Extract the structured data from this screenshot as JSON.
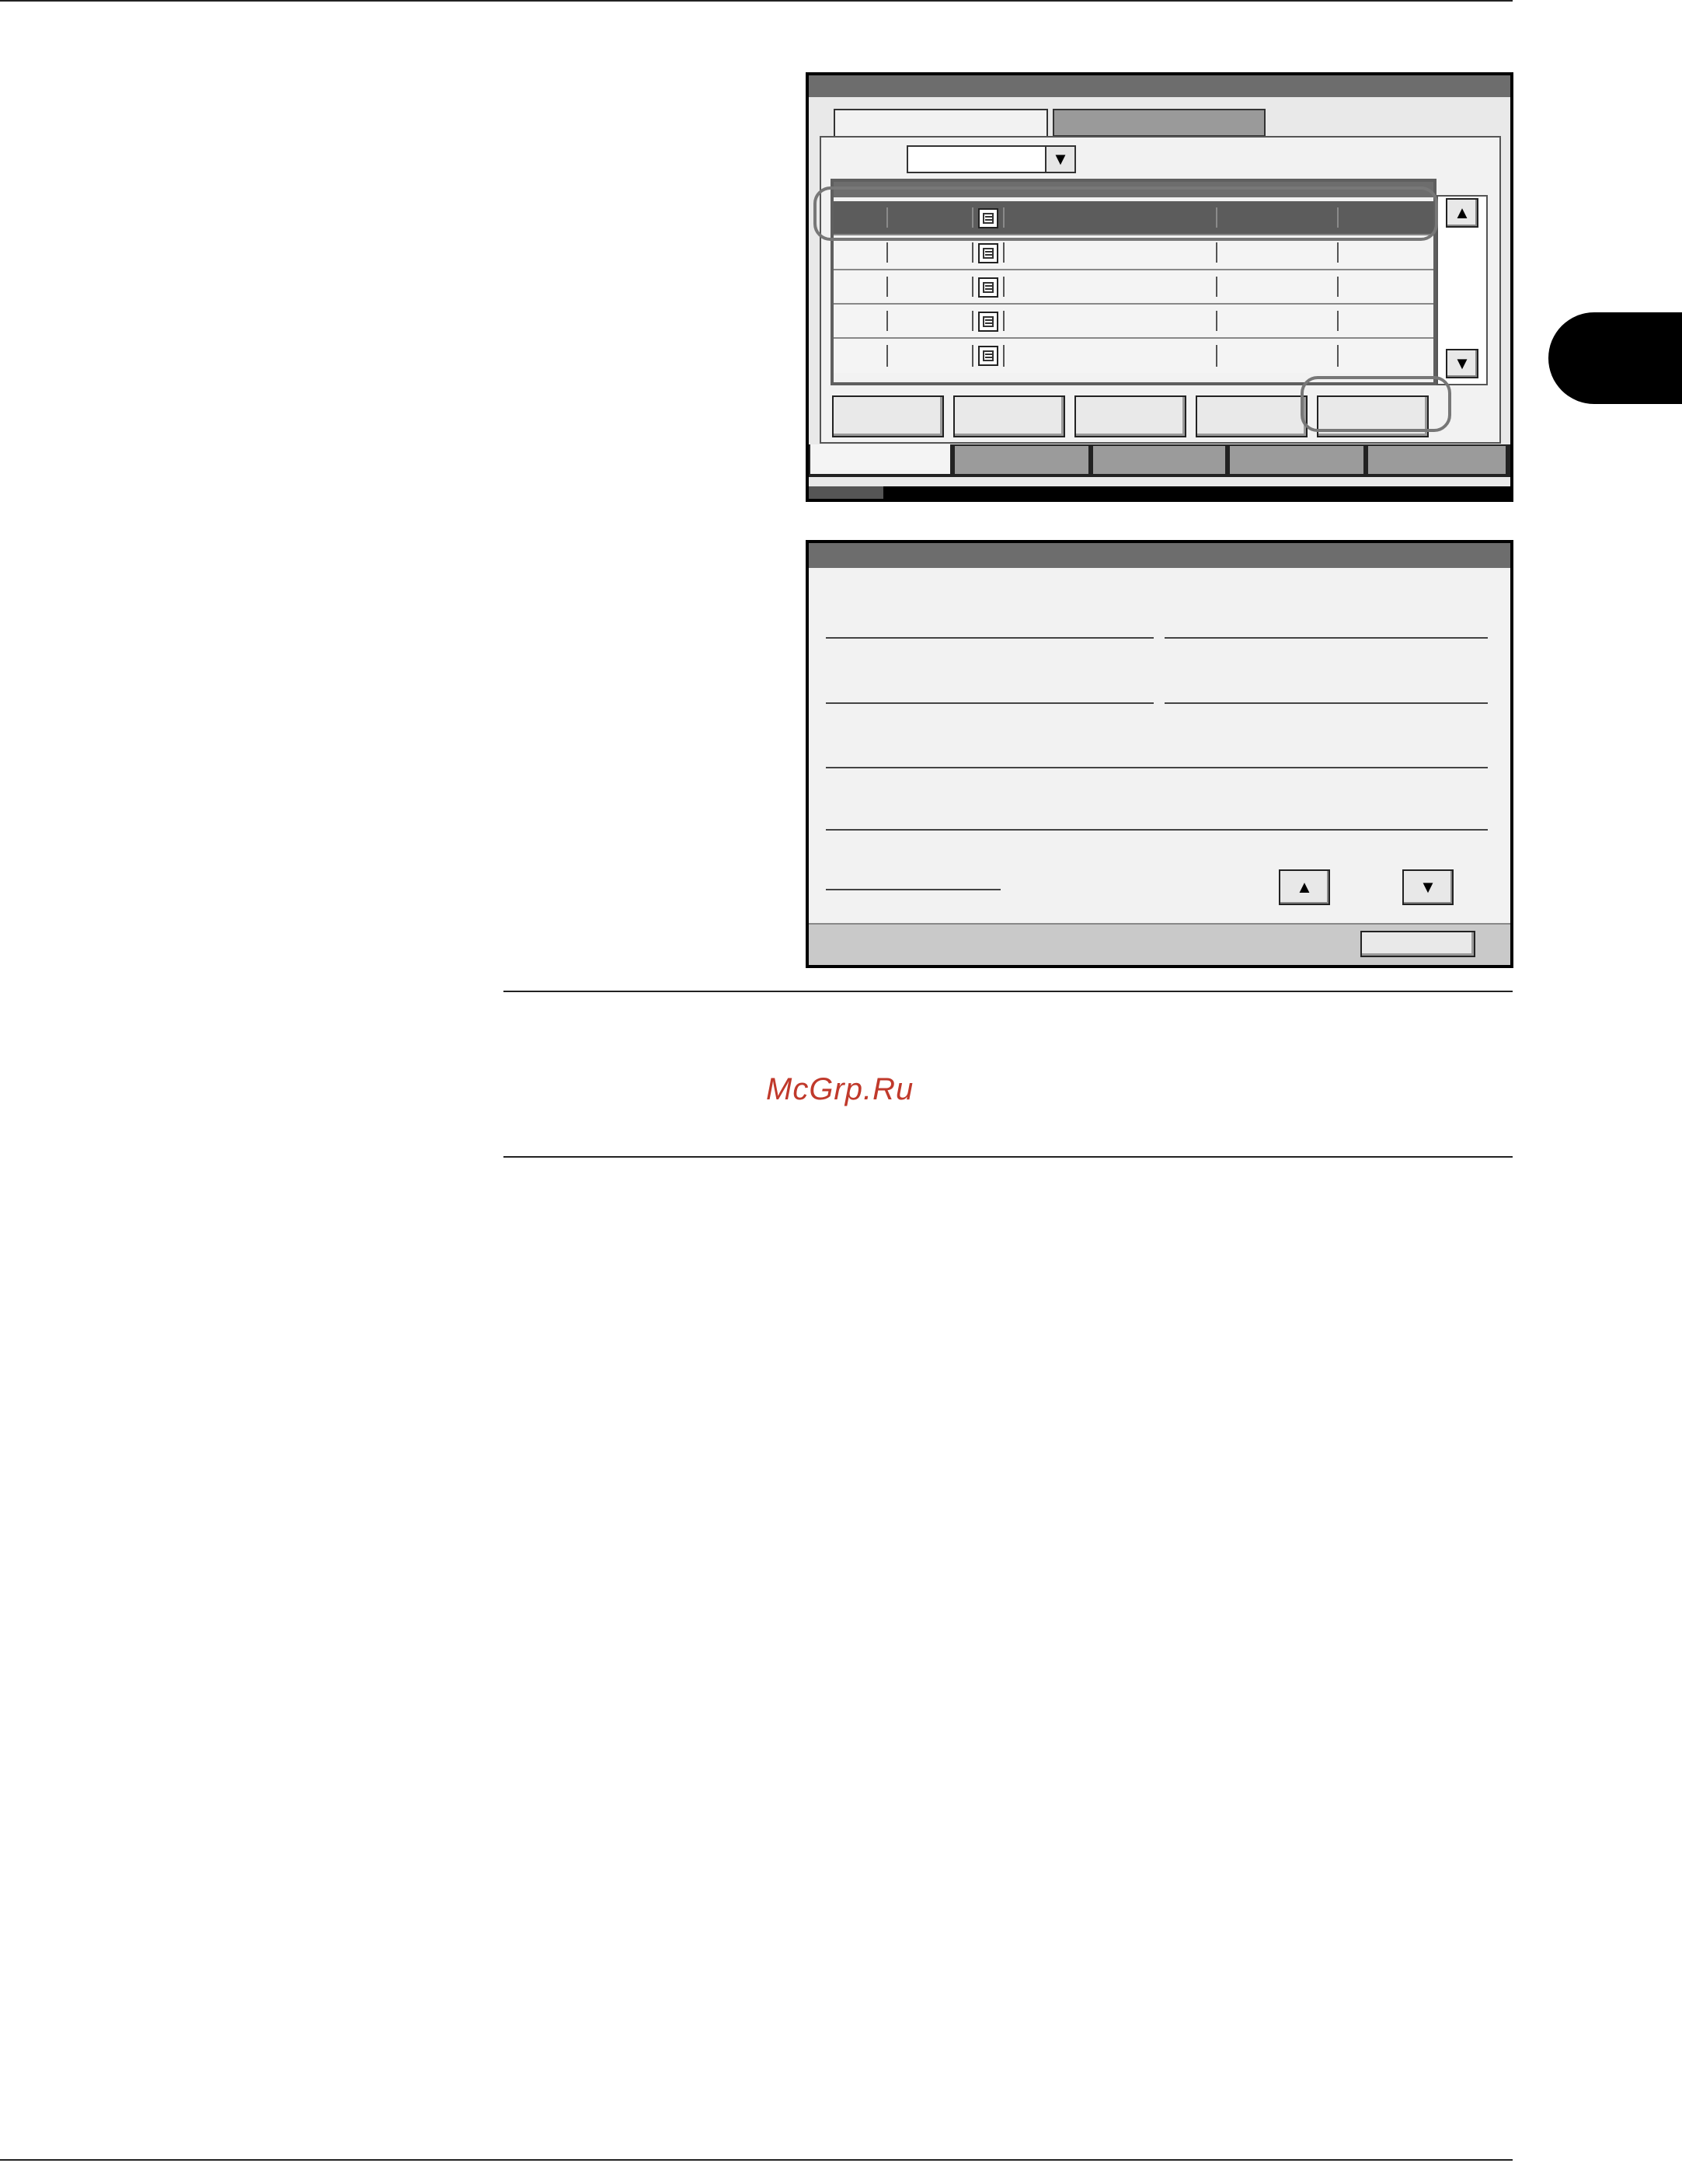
{
  "watermark": {
    "text": "McGrp.Ru"
  },
  "screen1": {
    "tabs": [
      "",
      ""
    ],
    "dropdown": {
      "value": "",
      "arrow_icon": "down-triangle-icon"
    },
    "list": {
      "rows": [
        {
          "selected": true,
          "icon": "document-icon"
        },
        {
          "selected": false,
          "icon": "document-icon"
        },
        {
          "selected": false,
          "icon": "document-icon"
        },
        {
          "selected": false,
          "icon": "document-icon"
        },
        {
          "selected": false,
          "icon": "document-icon"
        }
      ]
    },
    "action_buttons": [
      "",
      "",
      "",
      "",
      ""
    ],
    "bottom_tabs": [
      "",
      "",
      "",
      "",
      ""
    ]
  },
  "screen2": {
    "close_button": "",
    "scroll_up_icon": "up-triangle-icon",
    "scroll_down_icon": "down-triangle-icon"
  },
  "colors": {
    "title_bar": "#6d6d6d",
    "selected_row": "#5c5c5c",
    "highlight_ring": "#777777",
    "watermark": "#c0392b"
  }
}
